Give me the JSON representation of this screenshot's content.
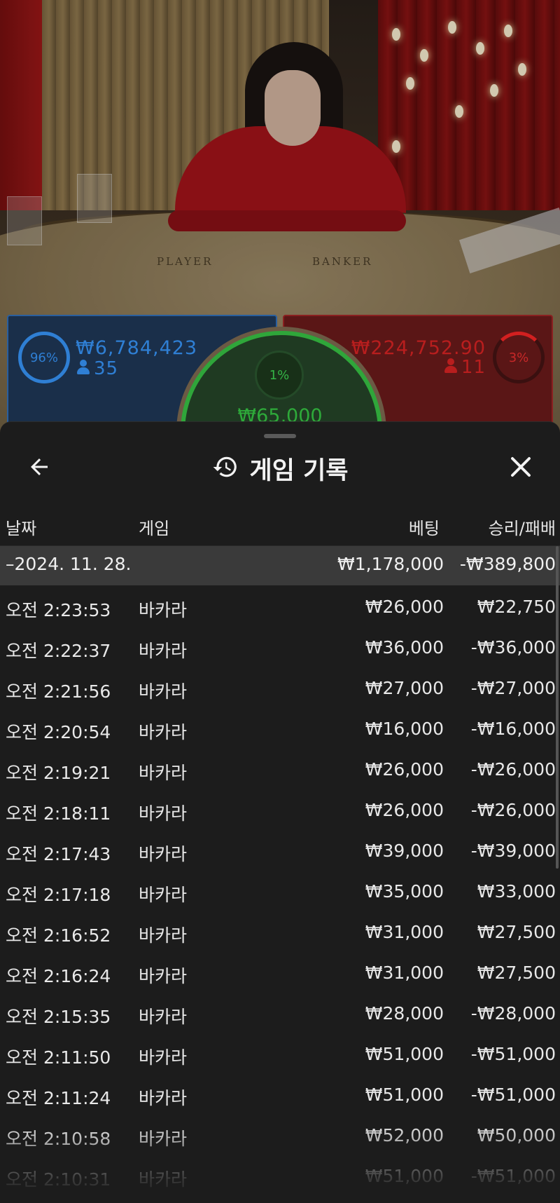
{
  "video": {
    "table_labels": {
      "player": "PLAYER",
      "banker": "BANKER"
    }
  },
  "bets": {
    "player": {
      "percent": "96%",
      "amount": "₩6,784,423",
      "players": "35",
      "color": "#2f7fd4"
    },
    "tie": {
      "percent": "1%",
      "amount": "₩65,000",
      "color": "#2fa63a"
    },
    "banker": {
      "percent": "3%",
      "amount": "₩224,752.90",
      "players": "11",
      "color": "#b81e1e"
    }
  },
  "sheet": {
    "title": "게임 기록",
    "icons": {
      "back": "arrow-left-icon",
      "history": "history-icon",
      "close": "close-icon"
    },
    "columns": {
      "date": "날짜",
      "game": "게임",
      "bet": "베팅",
      "win_loss": "승리/패배"
    },
    "date_group": {
      "date": "–2024. 11. 28.",
      "bet_total": "₩1,178,000",
      "win_total": "-₩389,800"
    },
    "rows": [
      {
        "time": "오전 2:23:53",
        "game": "바카라",
        "bet": "₩26,000",
        "result": "₩22,750"
      },
      {
        "time": "오전 2:22:37",
        "game": "바카라",
        "bet": "₩36,000",
        "result": "-₩36,000"
      },
      {
        "time": "오전 2:21:56",
        "game": "바카라",
        "bet": "₩27,000",
        "result": "-₩27,000"
      },
      {
        "time": "오전 2:20:54",
        "game": "바카라",
        "bet": "₩16,000",
        "result": "-₩16,000"
      },
      {
        "time": "오전 2:19:21",
        "game": "바카라",
        "bet": "₩26,000",
        "result": "-₩26,000"
      },
      {
        "time": "오전 2:18:11",
        "game": "바카라",
        "bet": "₩26,000",
        "result": "-₩26,000"
      },
      {
        "time": "오전 2:17:43",
        "game": "바카라",
        "bet": "₩39,000",
        "result": "-₩39,000"
      },
      {
        "time": "오전 2:17:18",
        "game": "바카라",
        "bet": "₩35,000",
        "result": "₩33,000"
      },
      {
        "time": "오전 2:16:52",
        "game": "바카라",
        "bet": "₩31,000",
        "result": "₩27,500"
      },
      {
        "time": "오전 2:16:24",
        "game": "바카라",
        "bet": "₩31,000",
        "result": "₩27,500"
      },
      {
        "time": "오전 2:15:35",
        "game": "바카라",
        "bet": "₩28,000",
        "result": "-₩28,000"
      },
      {
        "time": "오전 2:11:50",
        "game": "바카라",
        "bet": "₩51,000",
        "result": "-₩51,000"
      },
      {
        "time": "오전 2:11:24",
        "game": "바카라",
        "bet": "₩51,000",
        "result": "-₩51,000"
      },
      {
        "time": "오전 2:10:58",
        "game": "바카라",
        "bet": "₩52,000",
        "result": "₩50,000"
      },
      {
        "time": "오전 2:10:31",
        "game": "바카라",
        "bet": "₩51,000",
        "result": "-₩51,000"
      }
    ]
  }
}
